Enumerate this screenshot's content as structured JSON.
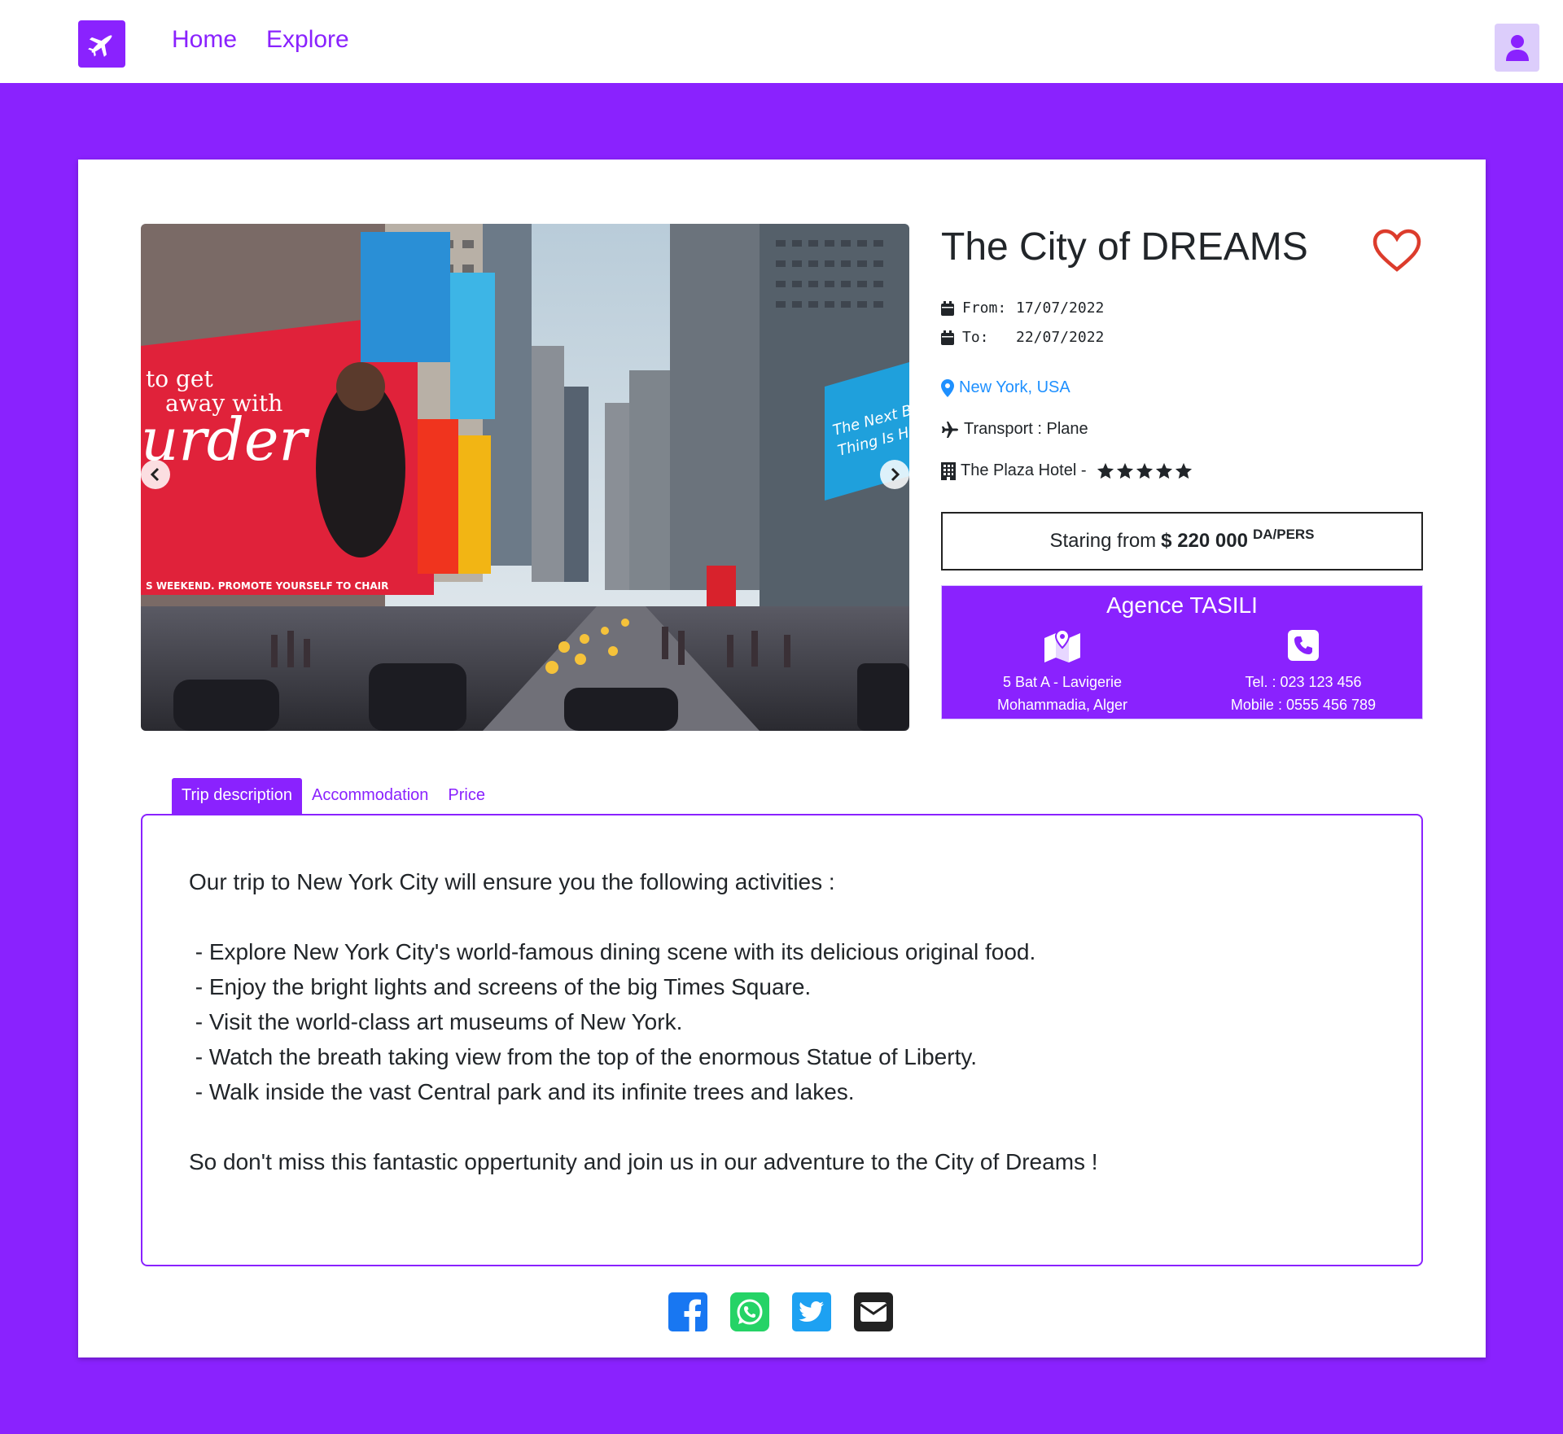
{
  "nav": {
    "home": "Home",
    "explore": "Explore"
  },
  "trip": {
    "title": "The City of DREAMS",
    "from_label": "From:",
    "from_date": "17/07/2022",
    "to_label": "To:",
    "to_date": "22/07/2022",
    "location": "New York, USA",
    "transport": "Transport : Plane",
    "hotel": "The Plaza Hotel -",
    "hotel_stars": 5
  },
  "price": {
    "prefix": "Staring from",
    "amount": "$ 220 000",
    "unit": "DA/PERS"
  },
  "agency": {
    "name": "Agence TASILI",
    "address_line1": "5 Bat A - Lavigerie",
    "address_line2": "Mohammadia, Alger",
    "tel": "Tel. : 023 123 456",
    "mobile": "Mobile : 0555 456 789"
  },
  "tabs": [
    "Trip description",
    "Accommodation",
    "Price"
  ],
  "description": {
    "intro": "Our trip to New York City will ensure you the following activities :",
    "items": [
      " - Explore New York City's world-famous dining scene with its delicious original food.",
      " - Enjoy the bright lights and screens of the big Times Square.",
      " - Visit the world-class art museums of New York.",
      " - Watch the breath taking view from the top of the enormous Statue of Liberty.",
      " - Walk inside the vast Central park and its infinite trees and lakes."
    ],
    "outro": "So don't miss this fantastic oppertunity and join us in our adventure to the City of Dreams !"
  },
  "colors": {
    "brand": "#8a22fe",
    "location": "#1e90ff",
    "heart": "#dc3c2c",
    "facebook": "#1877f2",
    "whatsapp": "#25d366",
    "twitter": "#1da1f2"
  }
}
